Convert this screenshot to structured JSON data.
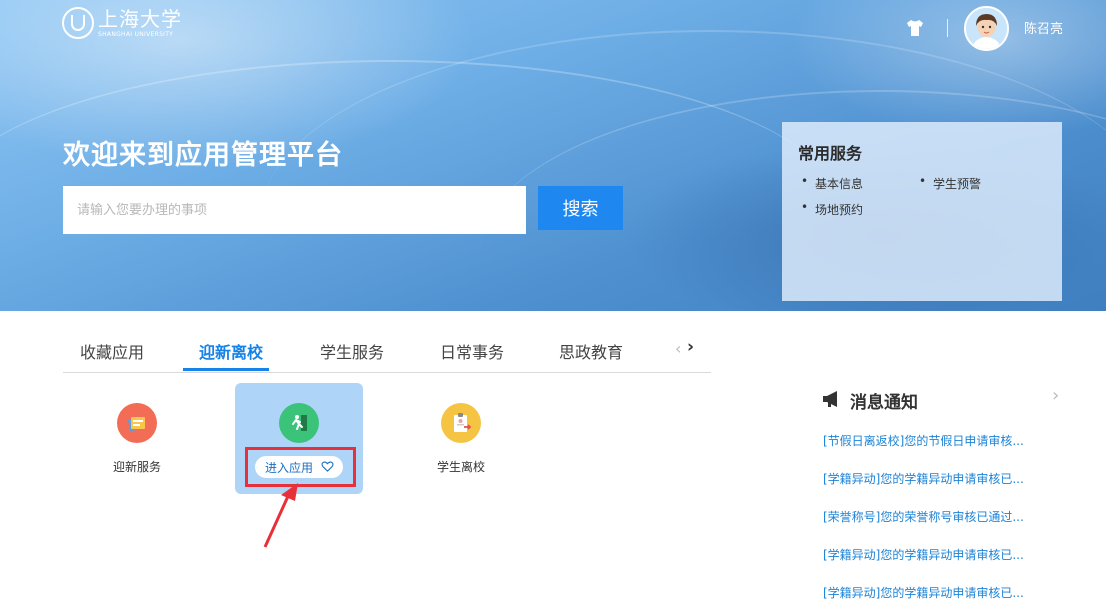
{
  "header": {
    "logo_cn": "上海大学",
    "logo_en": "SHANGHAI UNIVERSITY",
    "user_name": "陈召亮"
  },
  "hero": {
    "welcome": "欢迎来到应用管理平台",
    "search_placeholder": "请输入您要办理的事项",
    "search_button": "搜索"
  },
  "common_services": {
    "title": "常用服务",
    "items": [
      "基本信息",
      "学生预警",
      "场地预约"
    ]
  },
  "tabs": {
    "items": [
      "收藏应用",
      "迎新离校",
      "学生服务",
      "日常事务",
      "思政教育"
    ],
    "active": "迎新离校",
    "prev": "‹",
    "next": "›"
  },
  "apps": [
    {
      "label": "迎新服务",
      "icon": "document-stack-icon",
      "color": "#f36c55"
    },
    {
      "label": "进入应用",
      "icon": "running-exit-icon",
      "color": "#3cc37a",
      "hovered": true
    },
    {
      "label": "学生离校",
      "icon": "clipboard-exit-icon",
      "color": "#f6c443"
    }
  ],
  "news": {
    "title": "消息通知",
    "more": "›",
    "items": [
      "[节假日离返校]您的节假日申请审核...",
      "[学籍异动]您的学籍异动申请审核已...",
      "[荣誉称号]您的荣誉称号审核已通过...",
      "[学籍异动]您的学籍异动申请审核已...",
      "[学籍异动]您的学籍异动申请审核已..."
    ]
  },
  "colors": {
    "accent": "#1683e8",
    "search_button": "#1e88f0",
    "highlight": "#e8303a",
    "news_link": "#1c83d6"
  }
}
